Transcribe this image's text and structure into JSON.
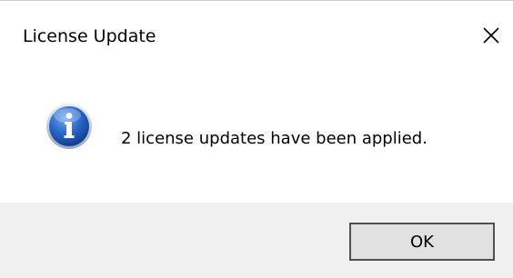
{
  "dialog": {
    "title": "License Update",
    "message": "2 license updates have been applied.",
    "ok_label": "OK"
  },
  "icons": {
    "close": "close-icon",
    "info": "information-icon"
  },
  "colors": {
    "footer_bg": "#f0f0f0",
    "button_bg": "#e1e1e1",
    "button_border": "#4f4f4f",
    "info_blue": "#1e5fbf"
  }
}
